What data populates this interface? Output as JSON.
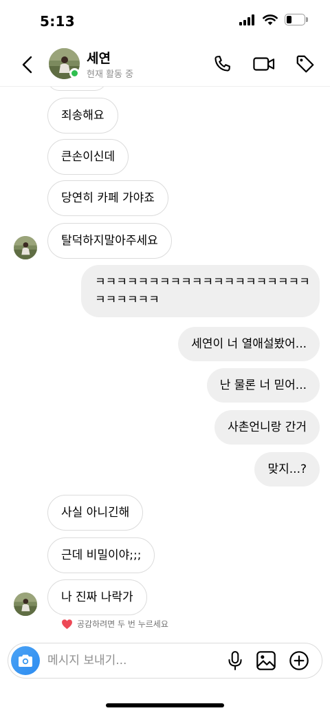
{
  "status_bar": {
    "time": "5:13",
    "battery_level": 0.3
  },
  "header": {
    "name": "세연",
    "status": "현재 활동 중",
    "online_color": "#2fbf4f",
    "icons": [
      "back-icon",
      "phone-icon",
      "video-icon",
      "tag-icon"
    ]
  },
  "messages": [
    {
      "from": "them",
      "text": "죄송해요"
    },
    {
      "from": "them",
      "text": "큰손이신데"
    },
    {
      "from": "them",
      "text": "당연히 카페 가야죠"
    },
    {
      "from": "them",
      "text": "탈덕하지말아주세요"
    },
    {
      "from": "me",
      "line1": "ㅋㅋㅋㅋㅋㅋㅋㅋㅋㅋㅋㅋㅋㅋㅋㅋㅋㅋㅋㅋ",
      "line2": "ㅋㅋㅋㅋㅋㅋ"
    },
    {
      "from": "me",
      "text": "세연이 너 열애설봤어..."
    },
    {
      "from": "me",
      "text": "난 물론 너 믿어..."
    },
    {
      "from": "me",
      "text": "사촌언니랑 간거"
    },
    {
      "from": "me",
      "text": "맞지...?"
    },
    {
      "from": "them",
      "text": "사실 아니긴해"
    },
    {
      "from": "them",
      "text": "근데 비밀이야;;;"
    },
    {
      "from": "them",
      "text": "나 진짜 나락가"
    }
  ],
  "reaction_hint": {
    "text": "공감하려면 두 번 누르세요",
    "icon": "heart-icon",
    "color": "#ed4956"
  },
  "composer": {
    "placeholder": "메시지 보내기...",
    "icons": [
      "camera-icon",
      "microphone-icon",
      "image-icon",
      "plus-circle-icon"
    ],
    "accent": "#3797f0"
  }
}
